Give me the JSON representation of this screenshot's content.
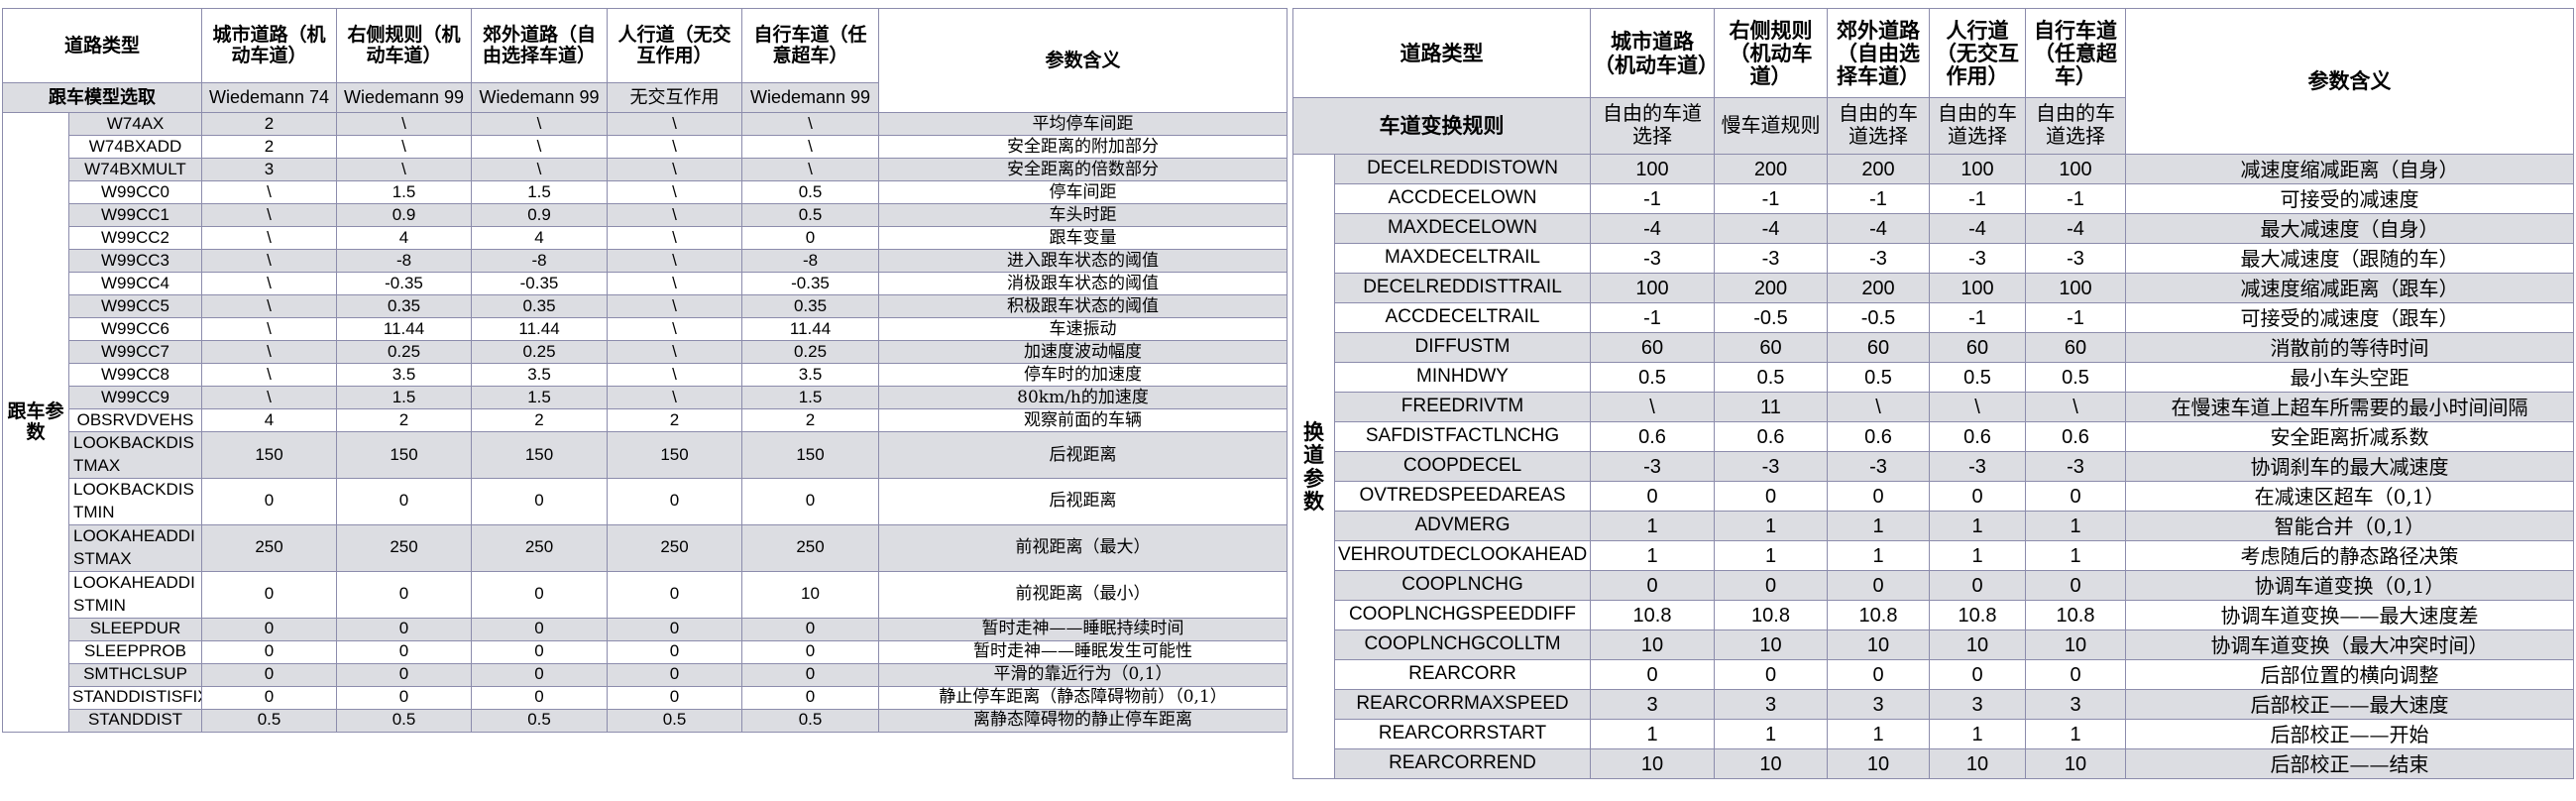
{
  "left_table": {
    "headers": [
      "道路类型",
      "城市道路（机动车道）",
      "右侧规则（机动车道）",
      "郊外道路（自由选择车道）",
      "人行道（无交互作用）",
      "自行车道（任意超车）",
      "参数含义"
    ],
    "subheader": {
      "label": "跟车模型选取",
      "values": [
        "Wiedemann 74",
        "Wiedemann 99",
        "Wiedemann 99",
        "无交互作用",
        "Wiedemann 99"
      ]
    },
    "group_label": "跟车参数",
    "rows": [
      {
        "param": "W74AX",
        "values": [
          "2",
          "\\",
          "\\",
          "\\",
          "\\"
        ],
        "meaning": "平均停车间距"
      },
      {
        "param": "W74BXADD",
        "values": [
          "2",
          "\\",
          "\\",
          "\\",
          "\\"
        ],
        "meaning": "安全距离的附加部分"
      },
      {
        "param": "W74BXMULT",
        "values": [
          "3",
          "\\",
          "\\",
          "\\",
          "\\"
        ],
        "meaning": "安全距离的倍数部分"
      },
      {
        "param": "W99CC0",
        "values": [
          "\\",
          "1.5",
          "1.5",
          "\\",
          "0.5"
        ],
        "meaning": "停车间距"
      },
      {
        "param": "W99CC1",
        "values": [
          "\\",
          "0.9",
          "0.9",
          "\\",
          "0.5"
        ],
        "meaning": "车头时距"
      },
      {
        "param": "W99CC2",
        "values": [
          "\\",
          "4",
          "4",
          "\\",
          "0"
        ],
        "meaning": "跟车变量"
      },
      {
        "param": "W99CC3",
        "values": [
          "\\",
          "-8",
          "-8",
          "\\",
          "-8"
        ],
        "meaning": "进入跟车状态的阈值"
      },
      {
        "param": "W99CC4",
        "values": [
          "\\",
          "-0.35",
          "-0.35",
          "\\",
          "-0.35"
        ],
        "meaning": "消极跟车状态的阈值"
      },
      {
        "param": "W99CC5",
        "values": [
          "\\",
          "0.35",
          "0.35",
          "\\",
          "0.35"
        ],
        "meaning": "积极跟车状态的阈值"
      },
      {
        "param": "W99CC6",
        "values": [
          "\\",
          "11.44",
          "11.44",
          "\\",
          "11.44"
        ],
        "meaning": "车速振动"
      },
      {
        "param": "W99CC7",
        "values": [
          "\\",
          "0.25",
          "0.25",
          "\\",
          "0.25"
        ],
        "meaning": "加速度波动幅度"
      },
      {
        "param": "W99CC8",
        "values": [
          "\\",
          "3.5",
          "3.5",
          "\\",
          "3.5"
        ],
        "meaning": "停车时的加速度"
      },
      {
        "param": "W99CC9",
        "values": [
          "\\",
          "1.5",
          "1.5",
          "\\",
          "1.5"
        ],
        "meaning": "80km/h的加速度"
      },
      {
        "param": "OBSRVDVEHS",
        "values": [
          "4",
          "2",
          "2",
          "2",
          "2"
        ],
        "meaning": "观察前面的车辆"
      },
      {
        "param": "LOOKBACKDISTMAX",
        "values": [
          "150",
          "150",
          "150",
          "150",
          "150"
        ],
        "meaning": "后视距离",
        "tall": true
      },
      {
        "param": "LOOKBACKDISTMIN",
        "values": [
          "0",
          "0",
          "0",
          "0",
          "0"
        ],
        "meaning": "后视距离",
        "tall": true
      },
      {
        "param": "LOOKAHEADDISTMAX",
        "values": [
          "250",
          "250",
          "250",
          "250",
          "250"
        ],
        "meaning": "前视距离（最大）",
        "tall": true
      },
      {
        "param": "LOOKAHEADDISTMIN",
        "values": [
          "0",
          "0",
          "0",
          "0",
          "10"
        ],
        "meaning": "前视距离（最小）",
        "tall": true
      },
      {
        "param": "SLEEPDUR",
        "values": [
          "0",
          "0",
          "0",
          "0",
          "0"
        ],
        "meaning": "暂时走神——睡眠持续时间"
      },
      {
        "param": "SLEEPPROB",
        "values": [
          "0",
          "0",
          "0",
          "0",
          "0"
        ],
        "meaning": "暂时走神——睡眠发生可能性"
      },
      {
        "param": "SMTHCLSUP",
        "values": [
          "0",
          "0",
          "0",
          "0",
          "0"
        ],
        "meaning": "平滑的靠近行为（0,1）"
      },
      {
        "param": "STANDDISTISFIX",
        "values": [
          "0",
          "0",
          "0",
          "0",
          "0"
        ],
        "meaning": "静止停车距离（静态障碍物前）（0,1）"
      },
      {
        "param": "STANDDIST",
        "values": [
          "0.5",
          "0.5",
          "0.5",
          "0.5",
          "0.5"
        ],
        "meaning": "离静态障碍物的静止停车距离"
      }
    ]
  },
  "right_table": {
    "headers": [
      "道路类型",
      "城市道路（机动车道）",
      "右侧规则（机动车道）",
      "郊外道路（自由选择车道）",
      "人行道（无交互作用）",
      "自行车道（任意超车）",
      "参数含义"
    ],
    "subheader": {
      "label": "车道变换规则",
      "values": [
        "自由的车道选择",
        "慢车道规则",
        "自由的车道选择",
        "自由的车道选择",
        "自由的车道选择"
      ]
    },
    "group_label": "换道参数",
    "rows": [
      {
        "param": "DECELREDDISTOWN",
        "values": [
          "100",
          "200",
          "200",
          "100",
          "100"
        ],
        "meaning": "减速度缩减距离（自身）"
      },
      {
        "param": "ACCDECELOWN",
        "values": [
          "-1",
          "-1",
          "-1",
          "-1",
          "-1"
        ],
        "meaning": "可接受的减速度"
      },
      {
        "param": "MAXDECELOWN",
        "values": [
          "-4",
          "-4",
          "-4",
          "-4",
          "-4"
        ],
        "meaning": "最大减速度（自身）"
      },
      {
        "param": "MAXDECELTRAIL",
        "values": [
          "-3",
          "-3",
          "-3",
          "-3",
          "-3"
        ],
        "meaning": "最大减速度（跟随的车）"
      },
      {
        "param": "DECELREDDISTTRAIL",
        "values": [
          "100",
          "200",
          "200",
          "100",
          "100"
        ],
        "meaning": "减速度缩减距离（跟车）"
      },
      {
        "param": "ACCDECELTRAIL",
        "values": [
          "-1",
          "-0.5",
          "-0.5",
          "-1",
          "-1"
        ],
        "meaning": "可接受的减速度（跟车）"
      },
      {
        "param": "DIFFUSTM",
        "values": [
          "60",
          "60",
          "60",
          "60",
          "60"
        ],
        "meaning": "消散前的等待时间"
      },
      {
        "param": "MINHDWY",
        "values": [
          "0.5",
          "0.5",
          "0.5",
          "0.5",
          "0.5"
        ],
        "meaning": "最小车头空距"
      },
      {
        "param": "FREEDRIVTM",
        "values": [
          "\\",
          "11",
          "\\",
          "\\",
          "\\"
        ],
        "meaning": "在慢速车道上超车所需要的最小时间间隔"
      },
      {
        "param": "SAFDISTFACTLNCHG",
        "values": [
          "0.6",
          "0.6",
          "0.6",
          "0.6",
          "0.6"
        ],
        "meaning": "安全距离折减系数"
      },
      {
        "param": "COOPDECEL",
        "values": [
          "-3",
          "-3",
          "-3",
          "-3",
          "-3"
        ],
        "meaning": "协调刹车的最大减速度"
      },
      {
        "param": "OVTREDSPEEDAREAS",
        "values": [
          "0",
          "0",
          "0",
          "0",
          "0"
        ],
        "meaning": "在减速区超车（0,1）"
      },
      {
        "param": "ADVMERG",
        "values": [
          "1",
          "1",
          "1",
          "1",
          "1"
        ],
        "meaning": "智能合并（0,1）"
      },
      {
        "param": "VEHROUTDECLOOKAHEAD",
        "values": [
          "1",
          "1",
          "1",
          "1",
          "1"
        ],
        "meaning": "考虑随后的静态路径决策"
      },
      {
        "param": "COOPLNCHG",
        "values": [
          "0",
          "0",
          "0",
          "0",
          "0"
        ],
        "meaning": "协调车道变换（0,1）"
      },
      {
        "param": "COOPLNCHGSPEEDDIFF",
        "values": [
          "10.8",
          "10.8",
          "10.8",
          "10.8",
          "10.8"
        ],
        "meaning": "协调车道变换——最大速度差"
      },
      {
        "param": "COOPLNCHGCOLLTM",
        "values": [
          "10",
          "10",
          "10",
          "10",
          "10"
        ],
        "meaning": "协调车道变换（最大冲突时间）"
      },
      {
        "param": "REARCORR",
        "values": [
          "0",
          "0",
          "0",
          "0",
          "0"
        ],
        "meaning": "后部位置的横向调整"
      },
      {
        "param": "REARCORRMAXSPEED",
        "values": [
          "3",
          "3",
          "3",
          "3",
          "3"
        ],
        "meaning": "后部校正——最大速度"
      },
      {
        "param": "REARCORRSTART",
        "values": [
          "1",
          "1",
          "1",
          "1",
          "1"
        ],
        "meaning": "后部校正——开始"
      },
      {
        "param": "REARCORREND",
        "values": [
          "10",
          "10",
          "10",
          "10",
          "10"
        ],
        "meaning": "后部校正——结束"
      }
    ]
  }
}
